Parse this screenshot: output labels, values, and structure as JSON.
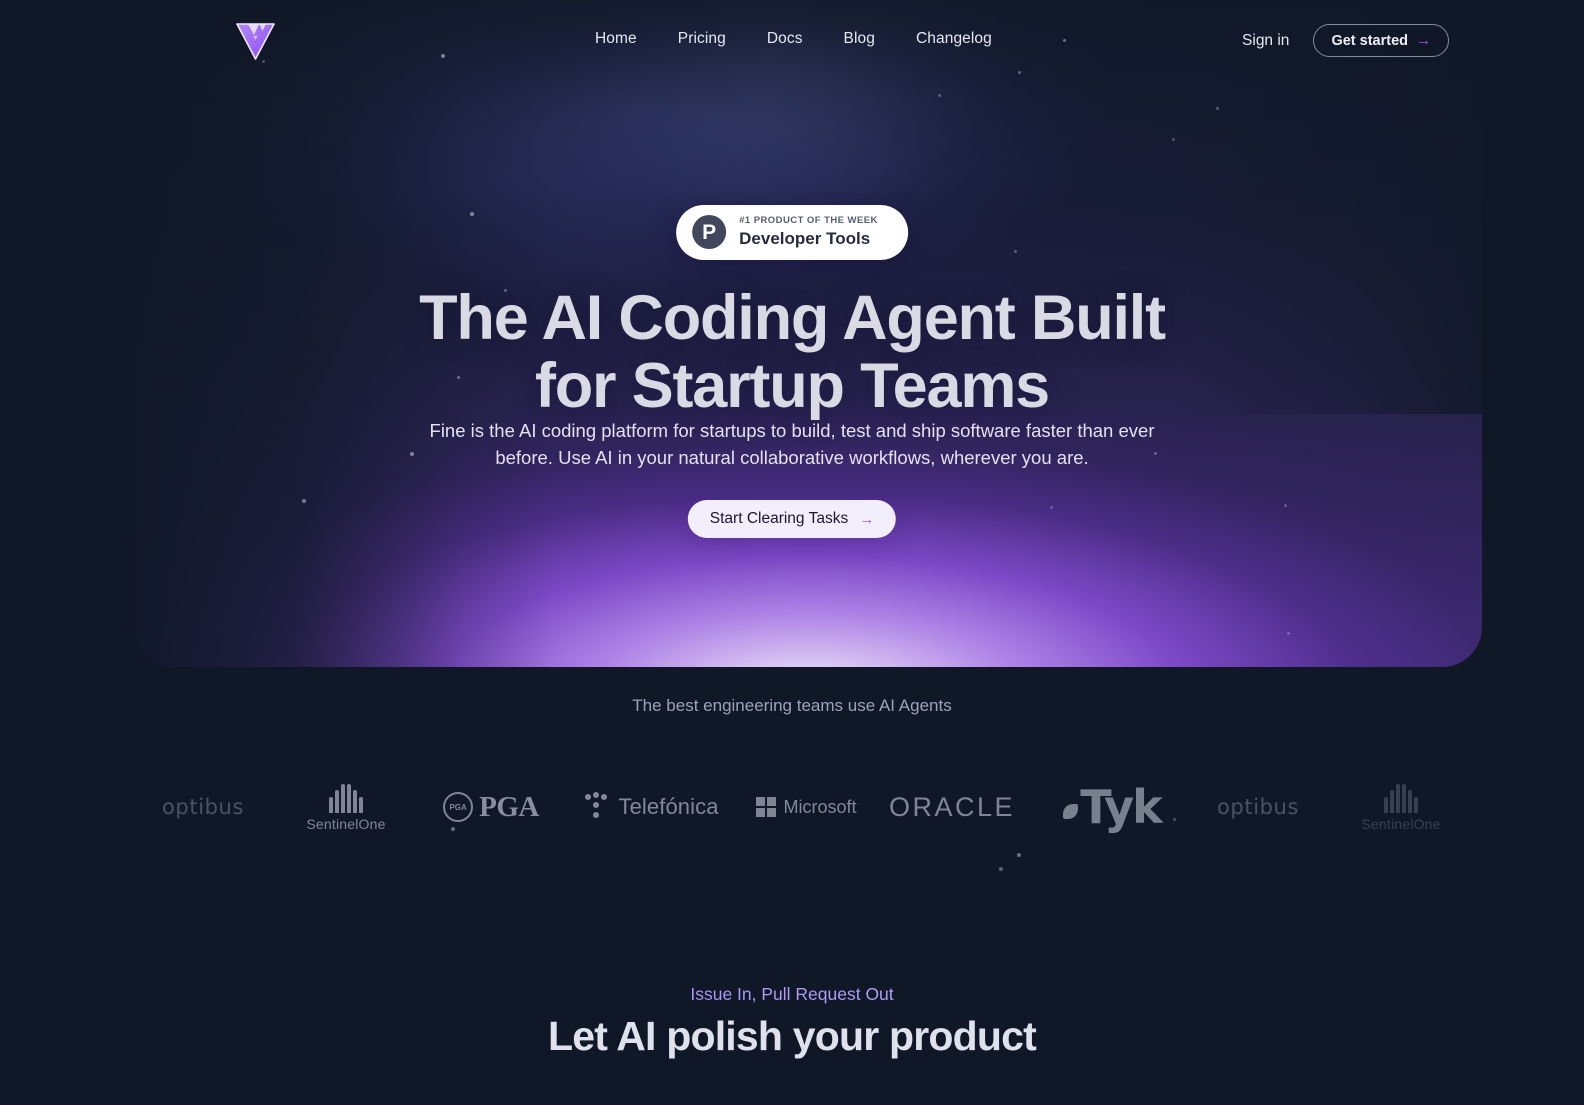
{
  "brand": {
    "logo_icon": "fine-triangle-logo",
    "accent": "#a855f7",
    "background": "#101827"
  },
  "nav": {
    "links": [
      {
        "label": "Home"
      },
      {
        "label": "Pricing"
      },
      {
        "label": "Docs"
      },
      {
        "label": "Blog"
      },
      {
        "label": "Changelog"
      }
    ],
    "signin_label": "Sign in",
    "get_started_label": "Get started",
    "arrow_glyph": "→"
  },
  "hero": {
    "badge": {
      "mark": "P",
      "kicker": "#1 PRODUCT OF THE WEEK",
      "title": "Developer Tools"
    },
    "headline_line1": "The AI Coding Agent Built",
    "headline_line2": "for Startup Teams",
    "subhead_line1": "Fine is the AI coding platform for startups to build, test and ship software faster than ever",
    "subhead_line2": "before. Use AI in your natural collaborative workflows, wherever you are.",
    "cta_label": "Start Clearing Tasks",
    "cta_arrow": "→"
  },
  "social_proof": {
    "caption": "The best engineering teams use AI Agents",
    "logos": [
      {
        "name": "optibus",
        "label": "optibus"
      },
      {
        "name": "sentinelone",
        "label": "SentinelOne"
      },
      {
        "name": "pga",
        "label": "PGA"
      },
      {
        "name": "telefonica",
        "label": "Telefónica"
      },
      {
        "name": "microsoft",
        "label": "Microsoft"
      },
      {
        "name": "oracle",
        "label": "ORACLE"
      },
      {
        "name": "tyk",
        "label": "Tyk"
      },
      {
        "name": "optibus",
        "label": "optibus"
      },
      {
        "name": "sentinelone",
        "label": "SentinelOne"
      }
    ]
  },
  "feature_section": {
    "eyebrow": "Issue In, Pull Request Out",
    "title": "Let AI polish your product"
  }
}
